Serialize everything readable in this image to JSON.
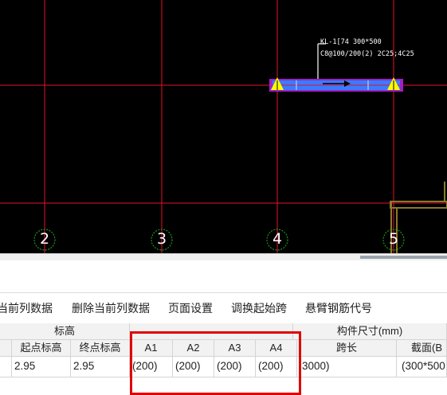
{
  "canvas": {
    "axis_labels": [
      "2",
      "3",
      "4",
      "5"
    ],
    "beam_label_line1": "KL-1[74  300*500",
    "beam_label_line2": "C8@100/200(2) 2C25;4C25",
    "colors": {
      "background": "#000000",
      "grid": "#e8102a",
      "beam": "#3a7bff",
      "support": "#ffff00",
      "axis_circle": "#1db31d"
    }
  },
  "toolbar": {
    "items": [
      "当前列数据",
      "删除当前列数据",
      "页面设置",
      "调换起始跨",
      "悬臂钢筋代号"
    ]
  },
  "table": {
    "group_elevation": "标高",
    "group_size": "构件尺寸(mm)",
    "headers": {
      "start_elev": "起点标高",
      "end_elev": "终点标高",
      "a1": "A1",
      "a2": "A2",
      "a3": "A3",
      "a4": "A4",
      "span": "跨长",
      "section": "截面(B"
    },
    "row": {
      "start_elev": "2.95",
      "end_elev": "2.95",
      "a1": "(200)",
      "a2": "(200)",
      "a3": "(200)",
      "a4": "(200)",
      "span": "3000)",
      "section": "(300*500"
    }
  },
  "highlight_color": "#e00000"
}
